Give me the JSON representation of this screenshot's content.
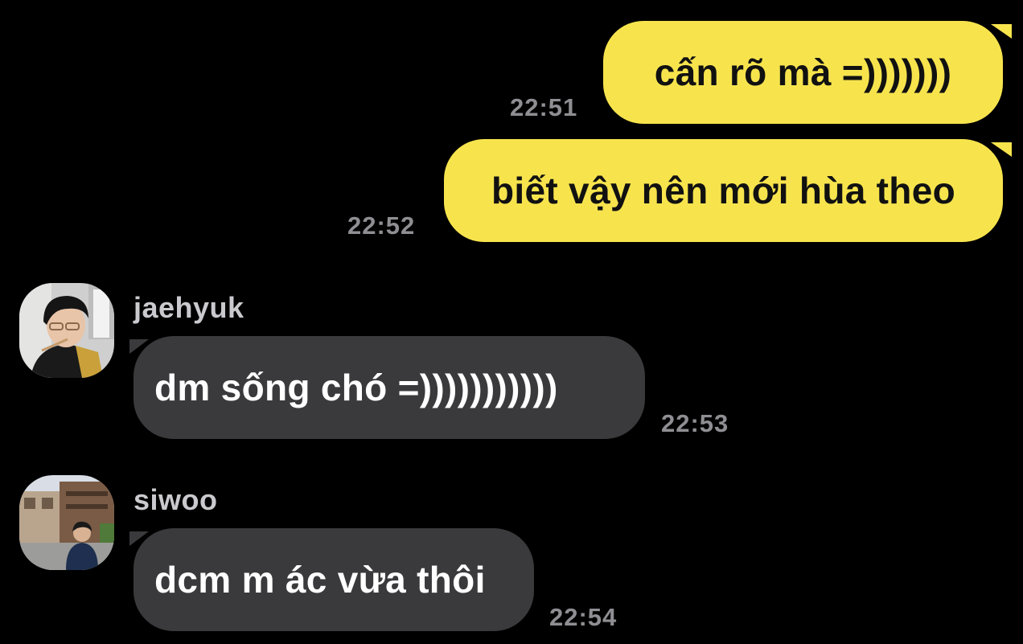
{
  "messages": [
    {
      "direction": "outgoing",
      "text": "cấn rõ mà =)))))))",
      "time": "22:51"
    },
    {
      "direction": "outgoing",
      "text": "biết vậy nên mới hùa theo",
      "time": "22:52"
    },
    {
      "direction": "incoming",
      "sender": "jaehyuk",
      "avatar_icon": "profile-photo-icon",
      "text": "dm sống chó =)))))))))))",
      "time": "22:53"
    },
    {
      "direction": "incoming",
      "sender": "siwoo",
      "avatar_icon": "profile-photo-icon",
      "text": "dcm m ác vừa thôi",
      "time": "22:54"
    }
  ],
  "colors": {
    "background": "#000000",
    "outgoing_bubble": "#F7E44D",
    "incoming_bubble": "#3A3A3C",
    "timestamp": "#8E8E93",
    "sender_name": "#C9C9CE"
  }
}
